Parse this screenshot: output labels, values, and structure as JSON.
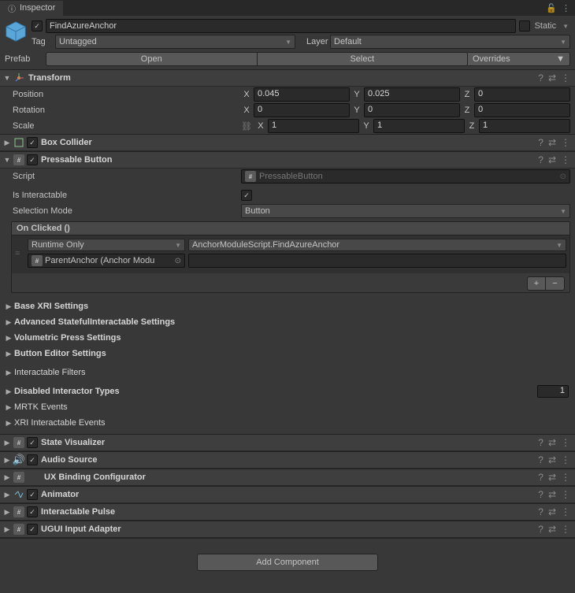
{
  "tab": {
    "title": "Inspector"
  },
  "header": {
    "enabled": true,
    "name": "FindAzureAnchor",
    "static_label": "Static",
    "tag_label": "Tag",
    "tag_value": "Untagged",
    "layer_label": "Layer",
    "layer_value": "Default",
    "prefab_label": "Prefab",
    "open_btn": "Open",
    "select_btn": "Select",
    "overrides_btn": "Overrides"
  },
  "transform": {
    "title": "Transform",
    "position_label": "Position",
    "position": {
      "x": "0.045",
      "y": "0.025",
      "z": "0"
    },
    "rotation_label": "Rotation",
    "rotation": {
      "x": "0",
      "y": "0",
      "z": "0"
    },
    "scale_label": "Scale",
    "scale": {
      "x": "1",
      "y": "1",
      "z": "1"
    }
  },
  "box_collider": {
    "title": "Box Collider",
    "enabled": true
  },
  "pressable": {
    "title": "Pressable Button",
    "enabled": true,
    "script_label": "Script",
    "script_value": "PressableButton",
    "is_interactable_label": "Is Interactable",
    "is_interactable": true,
    "selection_mode_label": "Selection Mode",
    "selection_mode_value": "Button",
    "event_title": "On Clicked ()",
    "runtime_mode": "Runtime Only",
    "method": "AnchorModuleScript.FindAzureAnchor",
    "target_object": "ParentAnchor (Anchor Modu",
    "argument": ""
  },
  "foldouts": {
    "base_xri": "Base XRI Settings",
    "advanced_stateful": "Advanced StatefulInteractable Settings",
    "volumetric": "Volumetric Press Settings",
    "button_editor": "Button Editor Settings",
    "interactable_filters": "Interactable Filters",
    "disabled_interactor": "Disabled Interactor Types",
    "disabled_interactor_count": "1",
    "mrtk_events": "MRTK Events",
    "xri_events": "XRI Interactable Events"
  },
  "components": {
    "state_visualizer": {
      "title": "State Visualizer",
      "enabled": true
    },
    "audio_source": {
      "title": "Audio Source",
      "enabled": true
    },
    "ux_binding": {
      "title": "UX Binding Configurator",
      "enabled": null
    },
    "animator": {
      "title": "Animator",
      "enabled": true
    },
    "interactable_pulse": {
      "title": "Interactable Pulse",
      "enabled": true
    },
    "ugui": {
      "title": "UGUI Input Adapter",
      "enabled": true
    }
  },
  "footer": {
    "add_component": "Add Component"
  },
  "axis": {
    "x": "X",
    "y": "Y",
    "z": "Z"
  }
}
